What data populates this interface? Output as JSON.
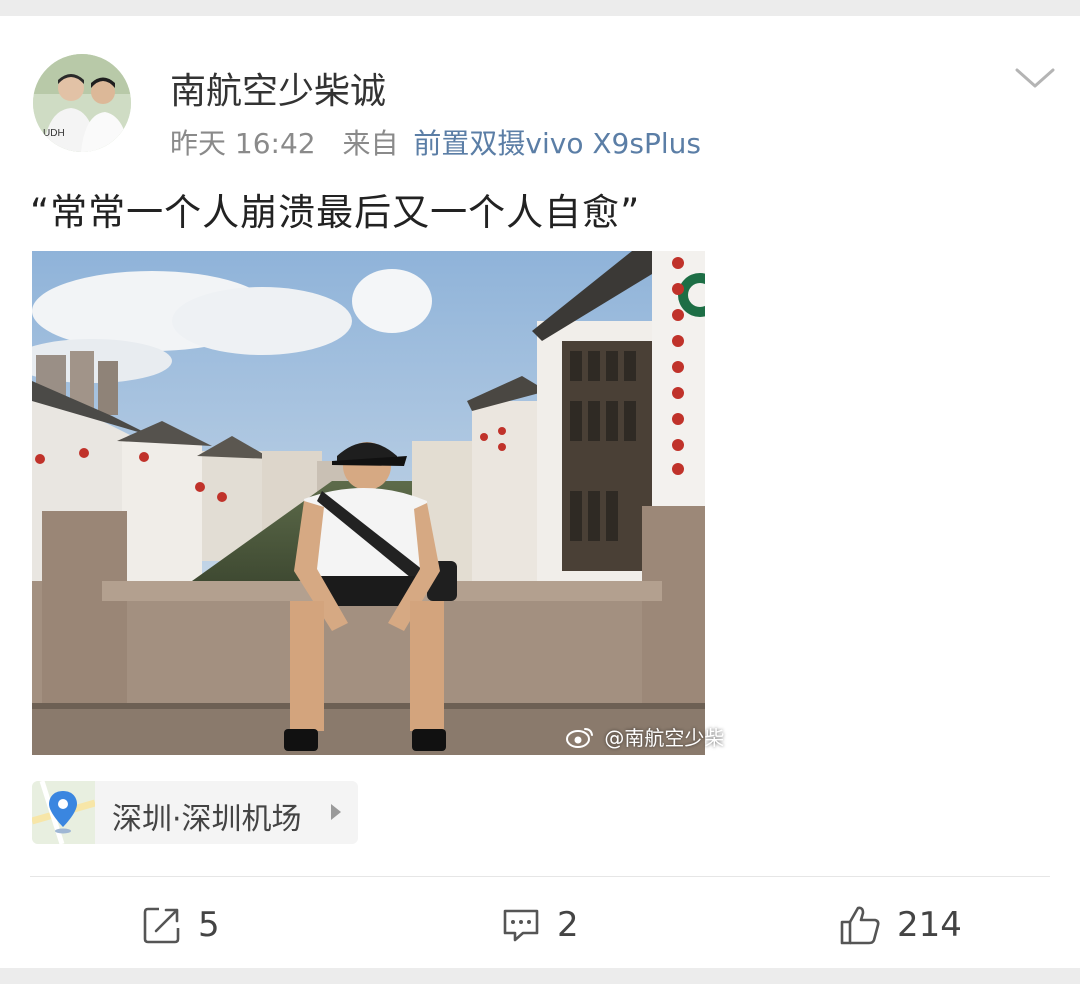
{
  "post": {
    "username": "南航空少柴诚",
    "time": "昨天 16:42",
    "source_prefix": "来自",
    "device": "前置双摄vivo X9sPlus",
    "text": "“常常一个人崩溃最后又一个人自愈”",
    "watermark": "@南航空少柴",
    "location": "深圳·深圳机场"
  },
  "actions": {
    "repost_count": "5",
    "comment_count": "2",
    "like_count": "214"
  },
  "icons": {
    "menu": "chevron-down-icon",
    "repost": "share-icon",
    "comment": "comment-icon",
    "like": "thumbs-up-icon",
    "location": "map-pin-icon",
    "weibo": "weibo-logo-icon"
  },
  "colors": {
    "device_link": "#5b7ea6",
    "text": "#222222",
    "meta": "#8a8a8a"
  }
}
